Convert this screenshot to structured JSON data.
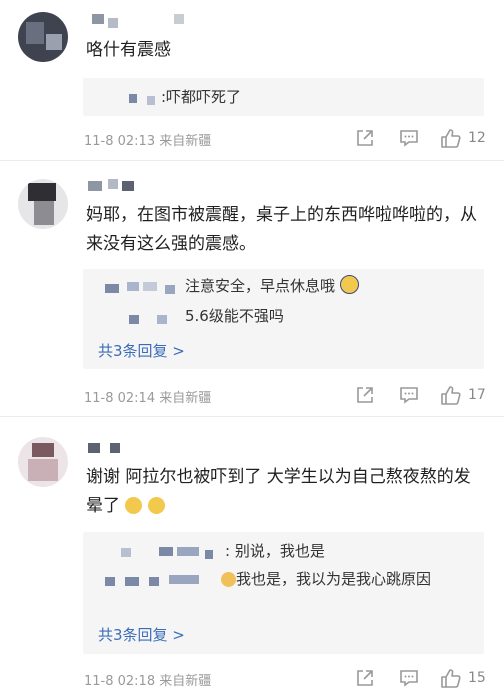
{
  "comments": [
    {
      "text": "咯什有震感",
      "replies": [
        {
          "text": ":吓都吓死了"
        }
      ],
      "more": "",
      "time": "11-8 02:13",
      "location": "来自新疆",
      "likes": "12"
    },
    {
      "text": "妈耶，在图市被震醒，桌子上的东西哗啦哗啦的，从来没有这么强的震感。",
      "replies": [
        {
          "text": "注意安全，早点休息哦"
        },
        {
          "text": "5.6级能不强吗"
        }
      ],
      "more": "共3条回复 >",
      "time": "11-8 02:14",
      "location": "来自新疆",
      "likes": "17"
    },
    {
      "text": "谢谢 阿拉尔也被吓到了 大学生以为自己熬夜熬的发晕了",
      "replies": [
        {
          "text": ": 别说，我也是"
        },
        {
          "text": "我也是，我以为是我心跳原因"
        }
      ],
      "more": "共3条回复 >",
      "time": "11-8 02:18",
      "location": "来自新疆",
      "likes": "15"
    }
  ],
  "icons": {
    "share": "share-icon",
    "comment": "comment-icon",
    "like": "thumbs-up-icon",
    "sleepy_emoji": "sleepy-emoji-icon",
    "crying_emoji": "crying-emoji-icon",
    "cat_emoji": "cat-emoji-icon"
  },
  "colors": {
    "link": "#3a6db8",
    "reply_bg": "#f5f5f6",
    "meta": "#9a9a9a"
  }
}
